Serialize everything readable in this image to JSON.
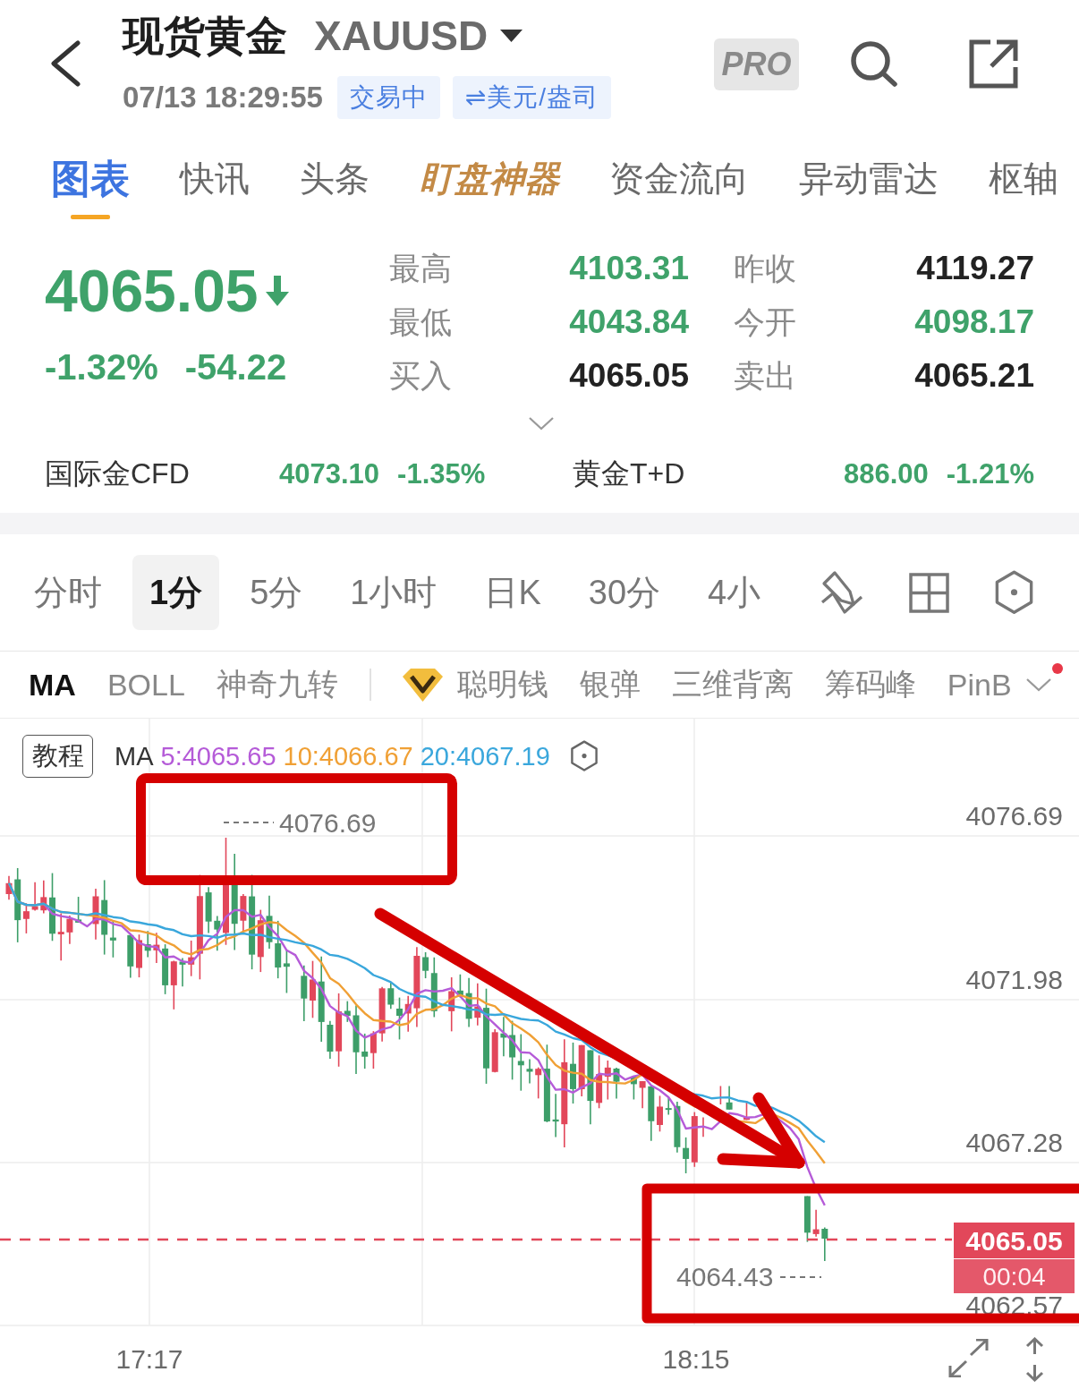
{
  "header": {
    "title": "现货黄金",
    "symbol": "XAUUSD",
    "timestamp": "07/13 18:29:55",
    "badges": [
      "交易中",
      "⇌美元/盎司"
    ],
    "pro_label": "PRO"
  },
  "tabs": [
    {
      "label": "图表",
      "selected": true,
      "kind": "plain"
    },
    {
      "label": "快讯",
      "selected": false,
      "kind": "plain"
    },
    {
      "label": "头条",
      "selected": false,
      "kind": "plain"
    },
    {
      "label": "盯盘神器",
      "selected": false,
      "kind": "premium"
    },
    {
      "label": "资金流向",
      "selected": false,
      "kind": "plain"
    },
    {
      "label": "异动雷达",
      "selected": false,
      "kind": "plain"
    },
    {
      "label": "枢轴",
      "selected": false,
      "kind": "plain"
    }
  ],
  "quote": {
    "price": "4065.05",
    "falling": true,
    "change_percent": "-1.32%",
    "change": "-54.22",
    "stats": [
      {
        "label": "最高",
        "value": "4103.31",
        "color": "#3fa26a"
      },
      {
        "label": "昨收",
        "value": "4119.27",
        "color": "#222222"
      },
      {
        "label": "最低",
        "value": "4043.84",
        "color": "#3fa26a"
      },
      {
        "label": "今开",
        "value": "4098.17",
        "color": "#3fa26a"
      },
      {
        "label": "买入",
        "value": "4065.05",
        "color": "#222222"
      },
      {
        "label": "卖出",
        "value": "4065.21",
        "color": "#222222"
      }
    ]
  },
  "related": [
    {
      "name": "国际金CFD",
      "price": "4073.10",
      "change": "-1.35%",
      "falling": true
    },
    {
      "name": "黄金T+D",
      "price": "886.00",
      "change": "-1.21%",
      "falling": true
    }
  ],
  "periods": [
    {
      "label": "分时",
      "selected": false
    },
    {
      "label": "1分",
      "selected": true
    },
    {
      "label": "5分",
      "selected": false
    },
    {
      "label": "1小时",
      "selected": false
    },
    {
      "label": "日K",
      "selected": false
    },
    {
      "label": "30分",
      "selected": false
    },
    {
      "label": "4小",
      "selected": false
    }
  ],
  "indicators": [
    {
      "label": "MA",
      "selected": true
    },
    {
      "label": "BOLL",
      "selected": false
    },
    {
      "label": "神奇九转",
      "selected": false
    }
  ],
  "tools": [
    {
      "label": "聪明钱",
      "selected": false,
      "kind": "premium"
    },
    {
      "label": "银弹",
      "selected": false,
      "kind": "plain"
    },
    {
      "label": "三维背离",
      "selected": false,
      "kind": "plain"
    },
    {
      "label": "筹码峰",
      "selected": false,
      "kind": "plain"
    },
    {
      "label": "PinB",
      "selected": false,
      "kind": "plain"
    }
  ],
  "more_has_alert": true,
  "chart": {
    "tutorial_button": "教程",
    "ma_title": "MA",
    "ma_legend": [
      {
        "label": "5:4065.65",
        "color": "#b55bd8"
      },
      {
        "label": "10:4066.67",
        "color": "#f0a035"
      },
      {
        "label": "20:4067.19",
        "color": "#3aa7dc"
      }
    ],
    "y_axis": [
      "4076.69",
      "4071.98",
      "4067.28",
      "4062.57"
    ],
    "x_axis": [
      "17:17",
      "18:15"
    ],
    "high_marker": "4076.69",
    "low_marker": "4064.43",
    "current_price": "4065.05",
    "countdown": "00:04"
  }
}
